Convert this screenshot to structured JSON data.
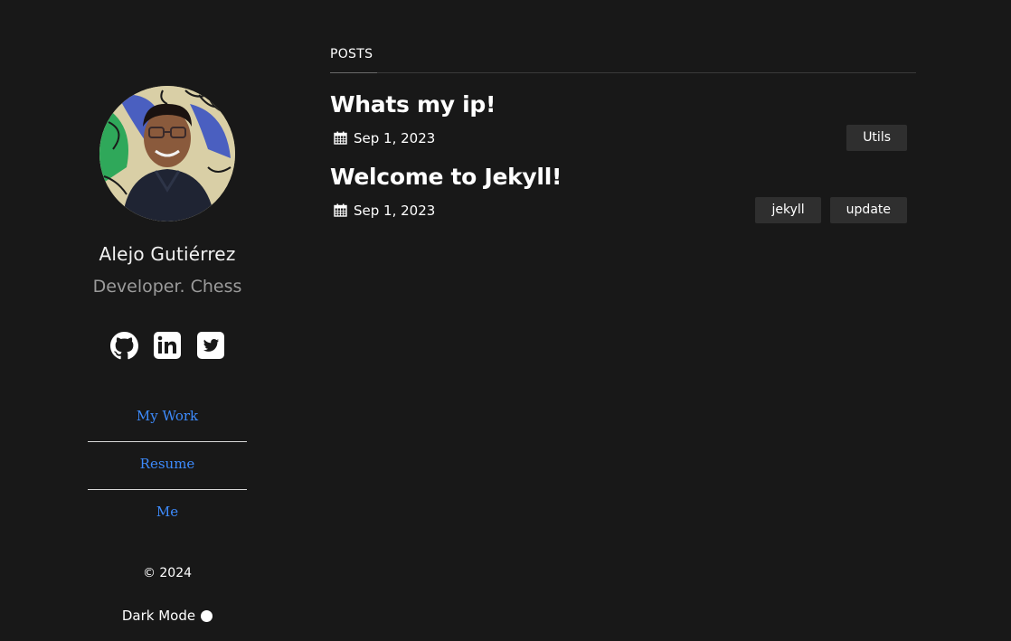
{
  "profile": {
    "name": "Alejo Gutiérrez",
    "tagline": "Developer. Chess"
  },
  "socials": [
    {
      "icon": "github-icon"
    },
    {
      "icon": "linkedin-icon"
    },
    {
      "icon": "twitter-icon"
    }
  ],
  "nav": {
    "items": [
      {
        "label": "My Work"
      },
      {
        "label": "Resume"
      },
      {
        "label": "Me"
      }
    ]
  },
  "footer": {
    "copyright": "© 2024",
    "dark_mode_label": "Dark Mode"
  },
  "posts_section": {
    "title": "POSTS",
    "posts": [
      {
        "title": "Whats my ip!",
        "date": "Sep 1, 2023",
        "tags": [
          "Utils"
        ]
      },
      {
        "title": "Welcome to Jekyll!",
        "date": "Sep 1, 2023",
        "tags": [
          "jekyll",
          "update"
        ]
      }
    ]
  },
  "colors": {
    "background": "#181818",
    "link": "#3d8bfd",
    "tag_background": "#2f2f2f",
    "muted_text": "#9b9b9b"
  }
}
